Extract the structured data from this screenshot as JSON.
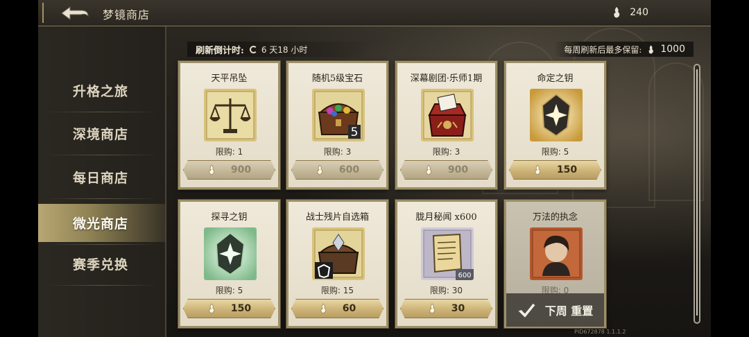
{
  "header": {
    "title": "梦镜商店",
    "currency_amount": "240"
  },
  "sidebar": {
    "items": [
      {
        "label": "升格之旅",
        "active": false
      },
      {
        "label": "深境商店",
        "active": false
      },
      {
        "label": "每日商店",
        "active": false
      },
      {
        "label": "微光商店",
        "active": true
      },
      {
        "label": "赛季兑换",
        "active": false
      }
    ]
  },
  "shop": {
    "refresh_label": "刷新倒计时:",
    "refresh_value": "6 天18 小时",
    "retain_label": "每周刷新后最多保留:",
    "retain_value": "1000",
    "items": [
      {
        "name": "天平吊坠",
        "limit": "限购: 1",
        "price": "900",
        "icon": "balance-pendant-icon",
        "purchasable": false
      },
      {
        "name": "随机5级宝石",
        "limit": "限购: 3",
        "price": "600",
        "icon": "treasure-chest-icon",
        "purchasable": false,
        "badge": "5"
      },
      {
        "name": "深幕剧团·乐师1期",
        "limit": "限购: 3",
        "price": "900",
        "icon": "music-box-icon",
        "purchasable": false
      },
      {
        "name": "命定之钥",
        "limit": "限购: 5",
        "price": "150",
        "icon": "golden-crystal-icon",
        "purchasable": true
      },
      {
        "name": "探寻之钥",
        "limit": "限购: 5",
        "price": "150",
        "icon": "green-crystal-icon",
        "purchasable": true
      },
      {
        "name": "战士残片自选箱",
        "limit": "限购: 15",
        "price": "60",
        "icon": "warrior-chest-icon",
        "purchasable": true
      },
      {
        "name": "胧月秘闻 x600",
        "limit": "限购: 30",
        "price": "30",
        "icon": "scroll-icon",
        "purchasable": true,
        "badge": "600"
      },
      {
        "name": "万法的执念",
        "limit": "限购: 0",
        "icon": "portrait-icon",
        "purchasable": false,
        "reset_text": "下周 重置"
      }
    ]
  },
  "footer": {
    "build_id": "PID672878  1.1.1.2"
  },
  "colors": {
    "card_bg": "#efe9da",
    "button_gold": "#cdb377",
    "active_tab": "#b8a774",
    "panel_dark": "#24211c"
  }
}
